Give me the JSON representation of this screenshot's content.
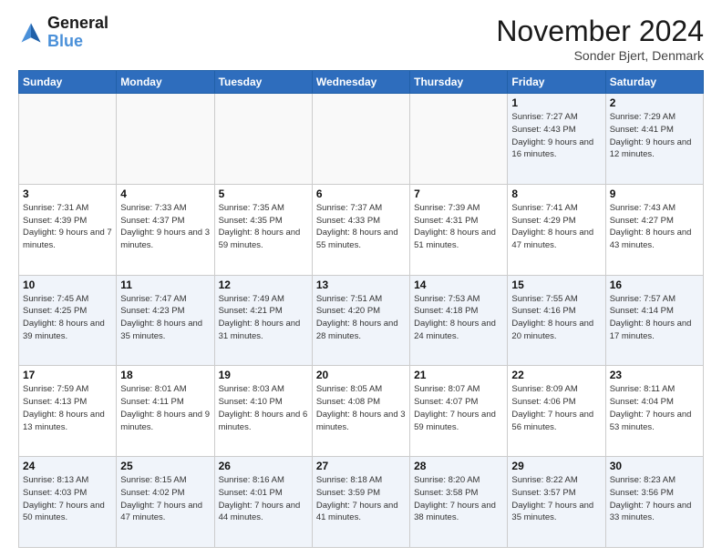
{
  "logo": {
    "line1": "General",
    "line2": "Blue"
  },
  "title": "November 2024",
  "subtitle": "Sonder Bjert, Denmark",
  "days_of_week": [
    "Sunday",
    "Monday",
    "Tuesday",
    "Wednesday",
    "Thursday",
    "Friday",
    "Saturday"
  ],
  "weeks": [
    [
      {
        "day": "",
        "info": "",
        "empty": true
      },
      {
        "day": "",
        "info": "",
        "empty": true
      },
      {
        "day": "",
        "info": "",
        "empty": true
      },
      {
        "day": "",
        "info": "",
        "empty": true
      },
      {
        "day": "",
        "info": "",
        "empty": true
      },
      {
        "day": "1",
        "info": "Sunrise: 7:27 AM\nSunset: 4:43 PM\nDaylight: 9 hours and 16 minutes."
      },
      {
        "day": "2",
        "info": "Sunrise: 7:29 AM\nSunset: 4:41 PM\nDaylight: 9 hours and 12 minutes."
      }
    ],
    [
      {
        "day": "3",
        "info": "Sunrise: 7:31 AM\nSunset: 4:39 PM\nDaylight: 9 hours and 7 minutes."
      },
      {
        "day": "4",
        "info": "Sunrise: 7:33 AM\nSunset: 4:37 PM\nDaylight: 9 hours and 3 minutes."
      },
      {
        "day": "5",
        "info": "Sunrise: 7:35 AM\nSunset: 4:35 PM\nDaylight: 8 hours and 59 minutes."
      },
      {
        "day": "6",
        "info": "Sunrise: 7:37 AM\nSunset: 4:33 PM\nDaylight: 8 hours and 55 minutes."
      },
      {
        "day": "7",
        "info": "Sunrise: 7:39 AM\nSunset: 4:31 PM\nDaylight: 8 hours and 51 minutes."
      },
      {
        "day": "8",
        "info": "Sunrise: 7:41 AM\nSunset: 4:29 PM\nDaylight: 8 hours and 47 minutes."
      },
      {
        "day": "9",
        "info": "Sunrise: 7:43 AM\nSunset: 4:27 PM\nDaylight: 8 hours and 43 minutes."
      }
    ],
    [
      {
        "day": "10",
        "info": "Sunrise: 7:45 AM\nSunset: 4:25 PM\nDaylight: 8 hours and 39 minutes."
      },
      {
        "day": "11",
        "info": "Sunrise: 7:47 AM\nSunset: 4:23 PM\nDaylight: 8 hours and 35 minutes."
      },
      {
        "day": "12",
        "info": "Sunrise: 7:49 AM\nSunset: 4:21 PM\nDaylight: 8 hours and 31 minutes."
      },
      {
        "day": "13",
        "info": "Sunrise: 7:51 AM\nSunset: 4:20 PM\nDaylight: 8 hours and 28 minutes."
      },
      {
        "day": "14",
        "info": "Sunrise: 7:53 AM\nSunset: 4:18 PM\nDaylight: 8 hours and 24 minutes."
      },
      {
        "day": "15",
        "info": "Sunrise: 7:55 AM\nSunset: 4:16 PM\nDaylight: 8 hours and 20 minutes."
      },
      {
        "day": "16",
        "info": "Sunrise: 7:57 AM\nSunset: 4:14 PM\nDaylight: 8 hours and 17 minutes."
      }
    ],
    [
      {
        "day": "17",
        "info": "Sunrise: 7:59 AM\nSunset: 4:13 PM\nDaylight: 8 hours and 13 minutes."
      },
      {
        "day": "18",
        "info": "Sunrise: 8:01 AM\nSunset: 4:11 PM\nDaylight: 8 hours and 9 minutes."
      },
      {
        "day": "19",
        "info": "Sunrise: 8:03 AM\nSunset: 4:10 PM\nDaylight: 8 hours and 6 minutes."
      },
      {
        "day": "20",
        "info": "Sunrise: 8:05 AM\nSunset: 4:08 PM\nDaylight: 8 hours and 3 minutes."
      },
      {
        "day": "21",
        "info": "Sunrise: 8:07 AM\nSunset: 4:07 PM\nDaylight: 7 hours and 59 minutes."
      },
      {
        "day": "22",
        "info": "Sunrise: 8:09 AM\nSunset: 4:06 PM\nDaylight: 7 hours and 56 minutes."
      },
      {
        "day": "23",
        "info": "Sunrise: 8:11 AM\nSunset: 4:04 PM\nDaylight: 7 hours and 53 minutes."
      }
    ],
    [
      {
        "day": "24",
        "info": "Sunrise: 8:13 AM\nSunset: 4:03 PM\nDaylight: 7 hours and 50 minutes."
      },
      {
        "day": "25",
        "info": "Sunrise: 8:15 AM\nSunset: 4:02 PM\nDaylight: 7 hours and 47 minutes."
      },
      {
        "day": "26",
        "info": "Sunrise: 8:16 AM\nSunset: 4:01 PM\nDaylight: 7 hours and 44 minutes."
      },
      {
        "day": "27",
        "info": "Sunrise: 8:18 AM\nSunset: 3:59 PM\nDaylight: 7 hours and 41 minutes."
      },
      {
        "day": "28",
        "info": "Sunrise: 8:20 AM\nSunset: 3:58 PM\nDaylight: 7 hours and 38 minutes."
      },
      {
        "day": "29",
        "info": "Sunrise: 8:22 AM\nSunset: 3:57 PM\nDaylight: 7 hours and 35 minutes."
      },
      {
        "day": "30",
        "info": "Sunrise: 8:23 AM\nSunset: 3:56 PM\nDaylight: 7 hours and 33 minutes."
      }
    ]
  ]
}
